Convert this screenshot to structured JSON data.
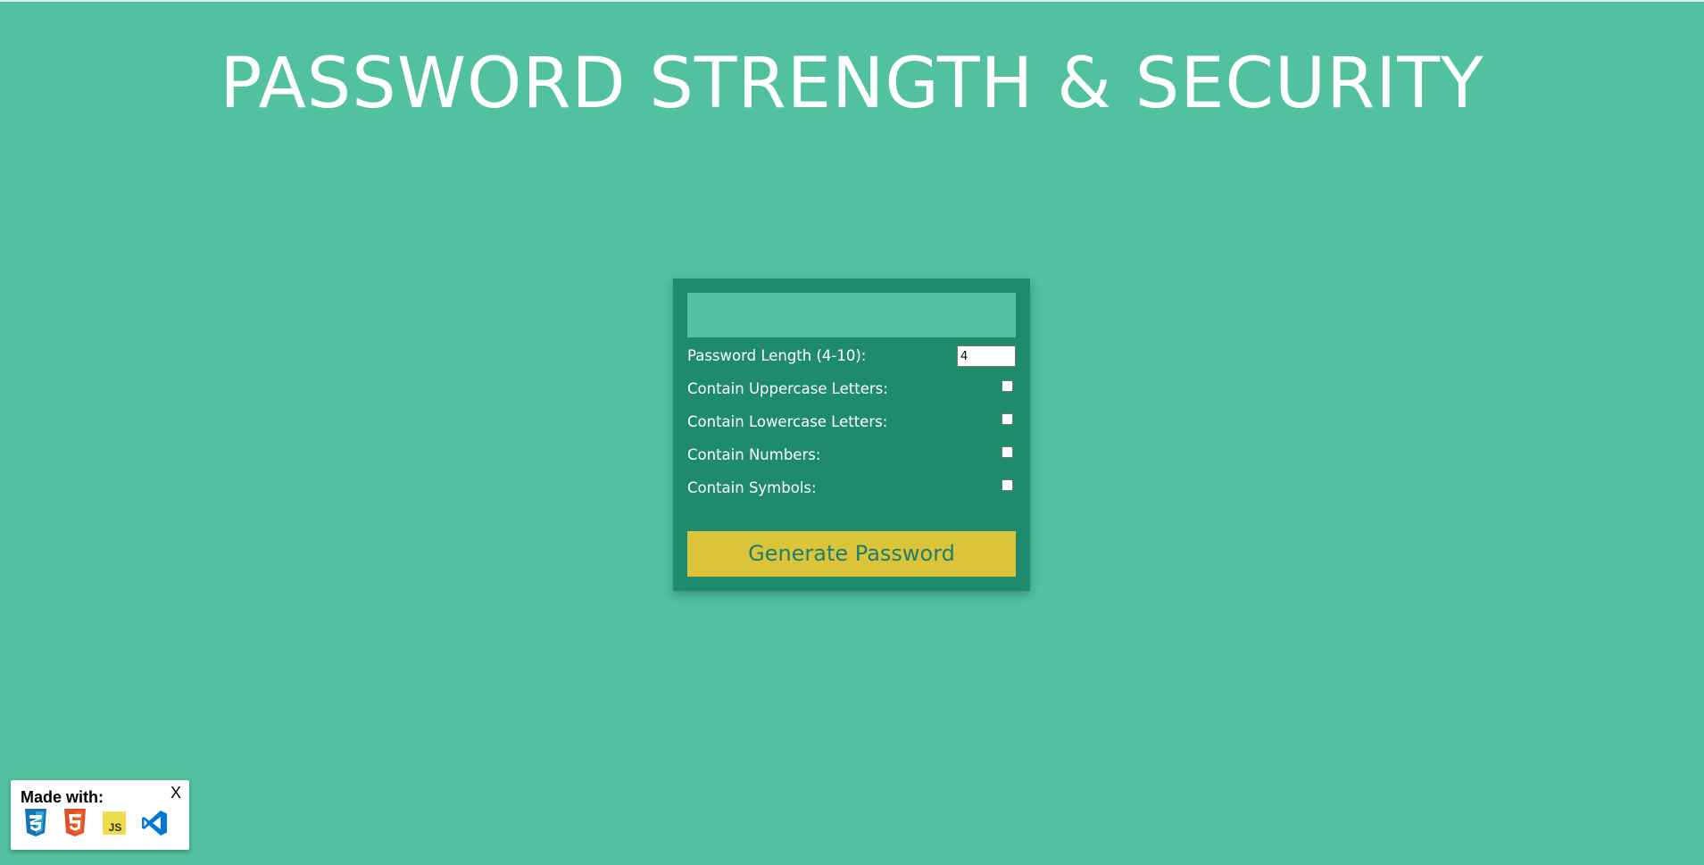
{
  "page": {
    "title": "PASSWORD STRENGTH & SECURITY"
  },
  "generator": {
    "result_value": "",
    "length_label": "Password Length (4-10):",
    "length_value": "4",
    "options": [
      {
        "label": "Contain Uppercase Letters:",
        "checked": false
      },
      {
        "label": "Contain Lowercase Letters:",
        "checked": false
      },
      {
        "label": "Contain Numbers:",
        "checked": false
      },
      {
        "label": "Contain Symbols:",
        "checked": false
      }
    ],
    "generate_label": "Generate Password"
  },
  "made_with": {
    "label": "Made with:",
    "close_label": "X",
    "icons": [
      "css3-icon",
      "html5-icon",
      "js-icon",
      "vscode-icon"
    ],
    "js_text": "JS"
  },
  "colors": {
    "background": "#51c1a0",
    "card": "#1f8b6d",
    "button": "#dcc43a",
    "button_text": "#1f7f6a"
  }
}
